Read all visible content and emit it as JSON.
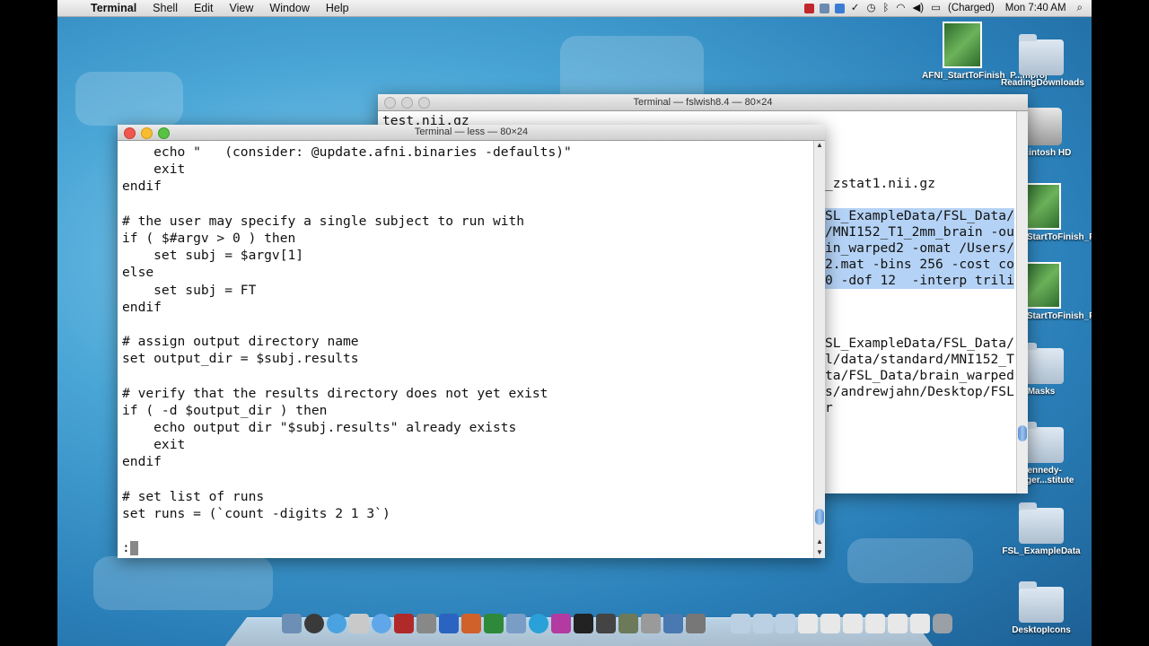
{
  "menubar": {
    "apple_glyph": "",
    "app_name": "Terminal",
    "menus": [
      "Shell",
      "Edit",
      "View",
      "Window",
      "Help"
    ],
    "battery": "(Charged)",
    "clock": "Mon 7:40 AM"
  },
  "back_window": {
    "title": "Terminal — fslwish8.4 — 80×24",
    "first_line": "test.nii.gz",
    "lines": [
      {
        "text": "_zstat1.nii.gz",
        "highlight": false
      },
      {
        "text": "SL_ExampleData/FSL_Data/",
        "highlight": true
      },
      {
        "text": "/MNI152_T1_2mm_brain -ou",
        "highlight": true
      },
      {
        "text": "in_warped2 -omat /Users/",
        "highlight": true
      },
      {
        "text": "2.mat -bins 256 -cost co",
        "highlight": true
      },
      {
        "text": "0 -dof 12  -interp trili",
        "highlight": true
      },
      {
        "text": "SL_ExampleData/FSL_Data/",
        "highlight": false
      },
      {
        "text": "l/data/standard/MNI152_T",
        "highlight": false
      },
      {
        "text": "ta/FSL_Data/brain_warped",
        "highlight": false
      },
      {
        "text": "s/andrewjahn/Desktop/FSL",
        "highlight": false
      },
      {
        "text": "r",
        "highlight": false
      }
    ]
  },
  "front_window": {
    "title": "Terminal — less — 80×24",
    "lines": [
      "    echo \"   (consider: @update.afni.binaries -defaults)\"",
      "    exit",
      "endif",
      "",
      "# the user may specify a single subject to run with",
      "if ( $#argv > 0 ) then",
      "    set subj = $argv[1]",
      "else",
      "    set subj = FT",
      "endif",
      "",
      "# assign output directory name",
      "set output_dir = $subj.results",
      "",
      "# verify that the results directory does not yet exist",
      "if ( -d $output_dir ) then",
      "    echo output dir \"$subj.results\" already exists",
      "    exit",
      "endif",
      "",
      "# set list of runs",
      "set runs = (`count -digits 2 1 3`)",
      "",
      ":"
    ]
  },
  "desktop_icons": [
    {
      "label": "AFNI_StartToFinish_P...mproj",
      "type": "film"
    },
    {
      "label": "ReadingDownloads",
      "type": "folder"
    },
    {
      "label": "Macintosh HD",
      "type": "hdd"
    },
    {
      "label": "AFNI_StartToFinish_P...mproj",
      "type": "film"
    },
    {
      "label": "AFNI_StartToFinish_P...mproj",
      "type": "film"
    },
    {
      "label": "Masks",
      "type": "folder"
    },
    {
      "label": "Kennedy-Krieger...stitute",
      "type": "folder"
    },
    {
      "label": "FSL_ExampleData",
      "type": "folder"
    },
    {
      "label": "DesktopIcons",
      "type": "folder"
    }
  ],
  "colors": {
    "close": "#f0584f",
    "minimize": "#f7bd2e",
    "zoom": "#58c243",
    "selection": "#b4d2f5"
  }
}
